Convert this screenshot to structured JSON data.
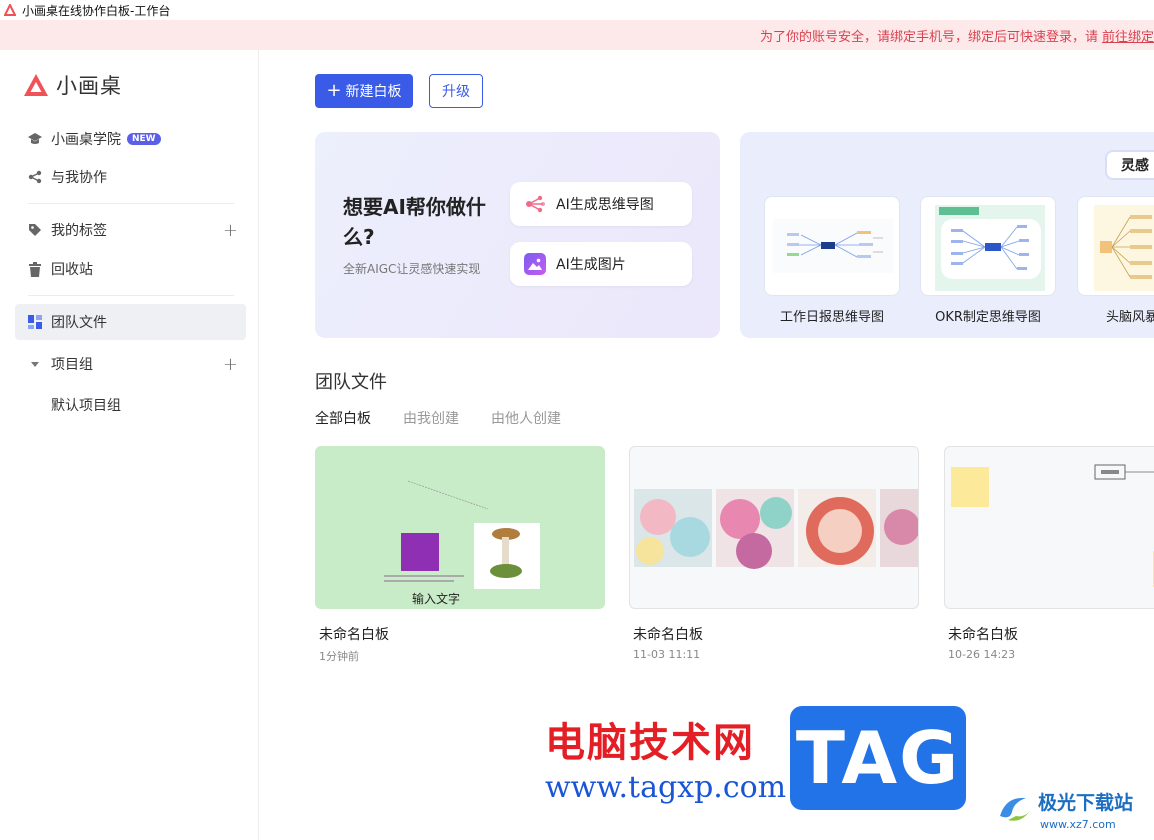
{
  "window": {
    "title": "小画桌在线协作白板-工作台"
  },
  "notice": {
    "text": "为了你的账号安全，请绑定手机号，绑定后可快速登录，请",
    "link": "前往绑定"
  },
  "brand": {
    "name": "小画桌",
    "color": "#f05258"
  },
  "sidebar": {
    "academy": "小画桌学院",
    "new_badge": "NEW",
    "shared": "与我协作",
    "tags": "我的标签",
    "trash": "回收站",
    "team_files": "团队文件",
    "project_group": "项目组",
    "default_project": "默认项目组"
  },
  "toolbar": {
    "new_board": "新建白板",
    "upgrade": "升级",
    "accent": "#3a5be8"
  },
  "ai_card": {
    "title": "想要AI帮你做什么?",
    "subtitle": "全新AIGC让灵感快速实现",
    "mindmap_btn": "AI生成思维导图",
    "image_btn": "AI生成图片"
  },
  "inspiration": {
    "tag": "灵感",
    "templates": [
      "工作日报思维导图",
      "OKR制定思维导图",
      "头脑风暴会议"
    ]
  },
  "files_section": {
    "title": "团队文件",
    "tabs": [
      "全部白板",
      "由我创建",
      "由他人创建"
    ],
    "active_tab": 0,
    "cards": [
      {
        "name": "未命名白板",
        "time": "1分钟前",
        "thumb_text": "输入文字"
      },
      {
        "name": "未命名白板",
        "time": "11-03 11:11"
      },
      {
        "name": "未命名白板",
        "time": "10-26 14:23"
      }
    ]
  },
  "watermark": {
    "site_name": "电脑技术网",
    "url": "www.tagxp.com",
    "tag": "TAG",
    "xz_name": "极光下载站",
    "xz_url": "www.xz7.com"
  }
}
